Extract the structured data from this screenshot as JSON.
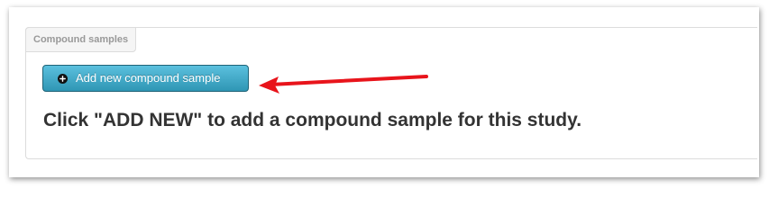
{
  "panel": {
    "tab_label": "Compound samples",
    "add_button_label": "Add new compound sample",
    "instruction_text": "Click \"ADD NEW\" to add a compound sample for this study."
  },
  "icons": {
    "add_button_icon": "plus-circle-icon",
    "callout": "red-arrow-icon"
  },
  "colors": {
    "button_top": "#5bc0de",
    "button_bottom": "#2f96b4",
    "arrow": "#e8141b",
    "instruction_text": "#333333",
    "tab_text": "#999999"
  }
}
